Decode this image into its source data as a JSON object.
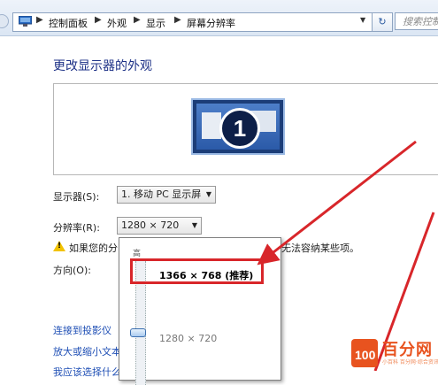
{
  "address_bar": {
    "crumbs": [
      "控制面板",
      "外观",
      "显示",
      "屏幕分辨率"
    ],
    "search_placeholder": "搜索控制面"
  },
  "main": {
    "title": "更改显示器的外观",
    "monitor_number": "1",
    "display_label": "显示器(S):",
    "display_value": "1. 移动 PC 显示屏",
    "resolution_label": "分辨率(R):",
    "resolution_value": "1280 × 720",
    "warning_prefix": "如果您的分",
    "warning_suffix": "无法容纳某些项。",
    "orientation_label": "方向(O):",
    "links": [
      "连接到投影仪",
      "放大或缩小文本",
      "我应该选择什么"
    ]
  },
  "resolution_popup": {
    "high_label": "高",
    "options": [
      "1366 × 768 (推荐)",
      "1280 × 720"
    ],
    "slider_position_fraction": 0.57
  },
  "watermark": {
    "logo_text": "百分网",
    "sub_text": "小百科 百分网·综合资讯平台"
  },
  "colors": {
    "title": "#1e3287",
    "link": "#1f4fb5",
    "highlight_red": "#d8262a",
    "watermark_orange": "#e8531f"
  }
}
